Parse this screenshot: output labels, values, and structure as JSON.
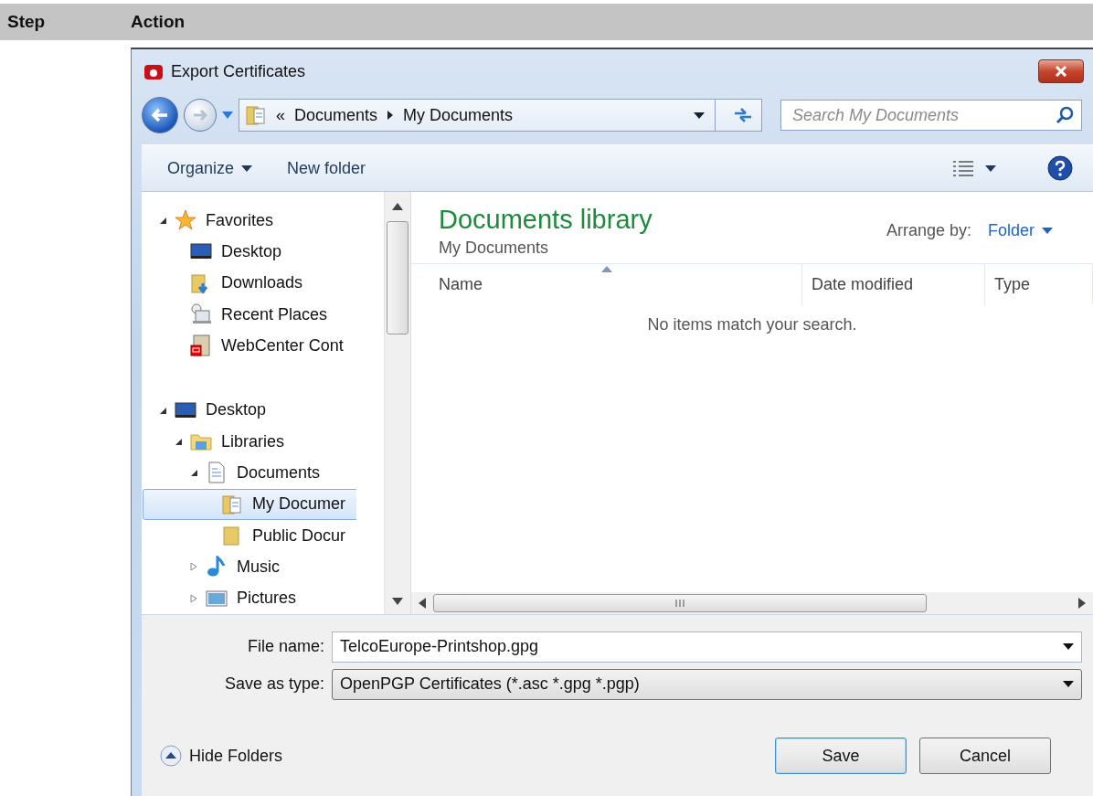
{
  "header": {
    "columns": [
      "Step",
      "Action"
    ]
  },
  "dialog": {
    "title": "Export Certificates",
    "address": {
      "overflow": "«",
      "segments": [
        "Documents",
        "My Documents"
      ]
    },
    "search": {
      "placeholder": "Search My Documents"
    },
    "toolbar": [
      {
        "label": "Organize",
        "dropdown": true
      },
      {
        "label": "New folder",
        "dropdown": false
      }
    ],
    "tree": [
      {
        "label": "Favorites",
        "kind": "star",
        "expanded": true,
        "selected": false,
        "children": [
          {
            "label": "Desktop",
            "kind": "desktop",
            "selected": false
          },
          {
            "label": "Downloads",
            "kind": "downloads",
            "selected": false
          },
          {
            "label": "Recent Places",
            "kind": "recent",
            "selected": false
          },
          {
            "label": "WebCenter Cont",
            "kind": "server",
            "selected": false
          }
        ]
      },
      {
        "label": "Desktop",
        "kind": "desktop",
        "expanded": true,
        "selected": false,
        "children": [
          {
            "label": "Libraries",
            "kind": "library",
            "expanded": true,
            "selected": false,
            "children": [
              {
                "label": "Documents",
                "kind": "document",
                "expanded": true,
                "selected": false,
                "children": [
                  {
                    "label": "My Documer",
                    "kind": "folderdoc",
                    "selected": true
                  },
                  {
                    "label": "Public Docur",
                    "kind": "folder",
                    "selected": false
                  }
                ]
              },
              {
                "label": "Music",
                "kind": "music",
                "expanded": false,
                "selected": false
              },
              {
                "label": "Pictures",
                "kind": "pictures",
                "expanded": false,
                "selected": false
              }
            ]
          }
        ]
      }
    ],
    "library": {
      "title": "Documents library",
      "subtitle": "My Documents",
      "arrange_label": "Arrange by:",
      "arrange_value": "Folder"
    },
    "columns": [
      {
        "label": "Name",
        "sorted": true
      },
      {
        "label": "Date modified",
        "sorted": false
      },
      {
        "label": "Type",
        "sorted": false
      }
    ],
    "empty_message": "No items match your search.",
    "fields": [
      {
        "label": "File name:",
        "value": "TelcoEurope-Printshop.gpg",
        "kind": "edit"
      },
      {
        "label": "Save as type:",
        "value": "OpenPGP Certificates (*.asc *.gpg *.pgp)",
        "kind": "dropdown"
      }
    ],
    "hide_folders": "Hide Folders",
    "buttons": [
      {
        "label": "Save",
        "default": true
      },
      {
        "label": "Cancel",
        "default": false
      }
    ]
  }
}
